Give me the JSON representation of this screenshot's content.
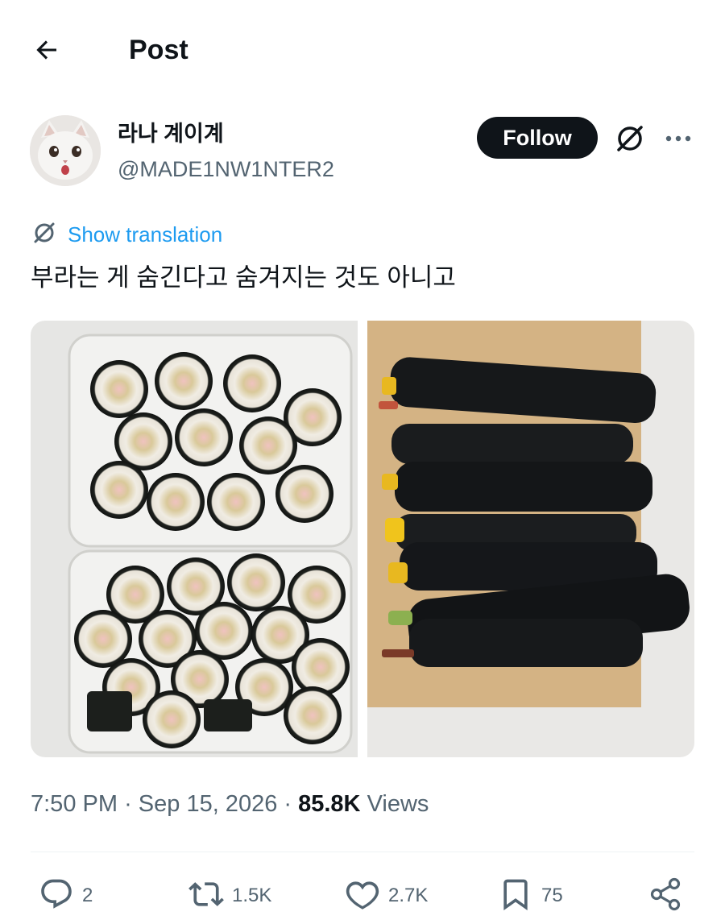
{
  "header": {
    "title": "Post"
  },
  "author": {
    "display_name": "라나 계이계",
    "handle": "@MADE1NW1NTER2"
  },
  "follow_label": "Follow",
  "translation_label": "Show translation",
  "tweet_text": "부라는 게 숨긴다고 숨겨지는 것도 아니고",
  "media": {
    "count": 2
  },
  "meta": {
    "time": "7:50 PM",
    "date": "Sep 15, 2026",
    "views_count": "85.8K",
    "views_label": "Views"
  },
  "actions": {
    "replies": "2",
    "reposts": "1.5K",
    "likes": "2.7K",
    "bookmarks": "75"
  },
  "colors": {
    "link": "#1d9bf0",
    "text": "#0f1419",
    "secondary": "#536471",
    "button_bg": "#0f1419"
  }
}
